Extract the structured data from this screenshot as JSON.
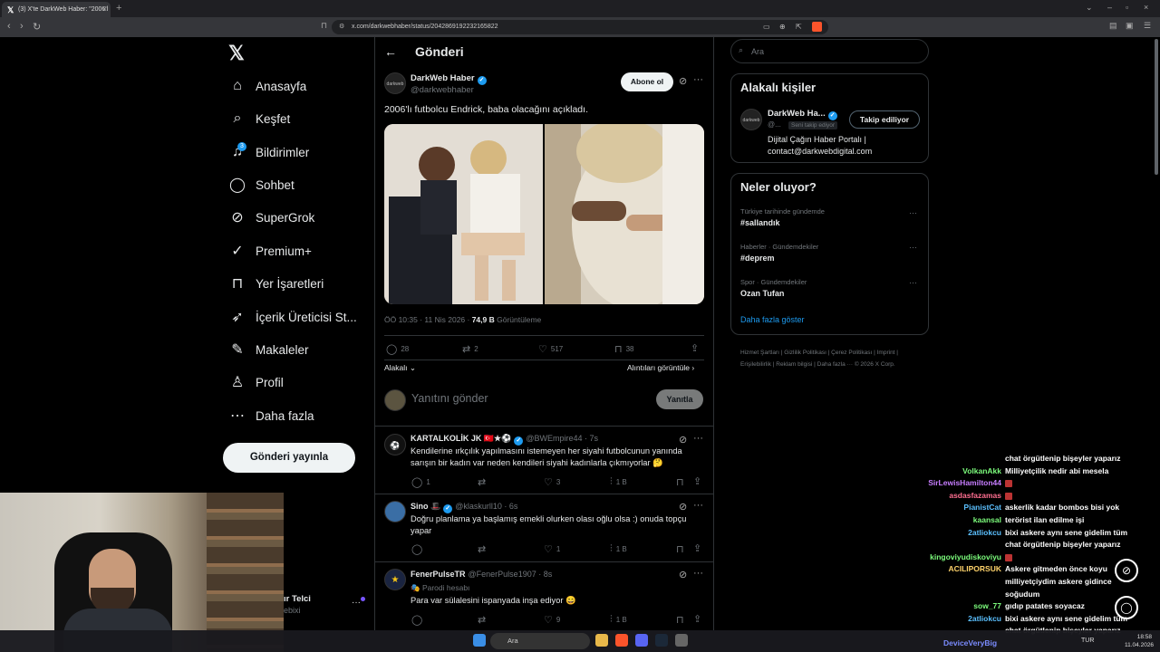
{
  "browser": {
    "tab_title": "(3) X'te DarkWeb Haber: \"2006'l",
    "url": "x.com/darkwebhaber/status/2042869192232165822"
  },
  "nav": {
    "items": [
      {
        "label": "Anasayfa",
        "icon": "home-icon"
      },
      {
        "label": "Keşfet",
        "icon": "search-icon"
      },
      {
        "label": "Bildirimler",
        "icon": "bell-icon"
      },
      {
        "label": "Sohbet",
        "icon": "chat-icon"
      },
      {
        "label": "SuperGrok",
        "icon": "grok-icon"
      },
      {
        "label": "Premium+",
        "icon": "verified-icon"
      },
      {
        "label": "Yer İşaretleri",
        "icon": "bookmark-icon"
      },
      {
        "label": "İçerik Üreticisi St...",
        "icon": "rocket-icon"
      },
      {
        "label": "Makaleler",
        "icon": "article-icon"
      },
      {
        "label": "Profil",
        "icon": "person-icon"
      },
      {
        "label": "Daha fazla",
        "icon": "more-circle-icon"
      }
    ],
    "notifications_badge": "3",
    "post_button": "Gönderi yayınla",
    "account_name": "ır Telci",
    "account_handle": "ebixi"
  },
  "post": {
    "page_title": "Gönderi",
    "author_name": "DarkWeb Haber",
    "author_handle": "@darkwebhaber",
    "avatar_text": "darkweb",
    "follow_label": "Abone ol",
    "text": "2006'lı futbolcu Endrick, baba olacağını açıkladı.",
    "time": "ÖÖ 10:35 · 11 Nis 2026 · ",
    "views_count": "74,9 B",
    "views_label": " Görüntüleme",
    "replies": "28",
    "reposts": "2",
    "likes": "517",
    "bookmarks": "38",
    "sort_label": "Alakalı",
    "quotes_label": "Alıntıları görüntüle",
    "reply_placeholder": "Yanıtını gönder",
    "reply_button": "Yanıtla"
  },
  "replies": [
    {
      "name": "KARTALKOLİK JK 🇹🇷★⚽",
      "handle": "@BWEmpire44 · 7s",
      "text": "Kendilerine ırkçılık yapılmasını istemeyen her siyahi futbolcunun yanında sarışın bir kadın var neden kendileri  siyahi kadınlarla çıkmıyorlar 🤔",
      "replies": "1",
      "likes": "3",
      "views": "1 B"
    },
    {
      "name": "Sino 🎩",
      "handle": "@klaskurll10 · 6s",
      "text": "Doğru planlama ya başlamış emekli olurken olası oğlu olsa :) onuda topçu yapar",
      "replies": "",
      "likes": "1",
      "views": "1 B"
    },
    {
      "name": "FenerPulseTR",
      "handle": "@FenerPulse1907 · 8s",
      "parody": "Parodi hesabı",
      "text": "Para var sülalesini ispanyada inşa ediyor 😄",
      "replies": "",
      "likes": "9",
      "views": "1 B"
    }
  ],
  "right": {
    "search_placeholder": "Ara",
    "related_title": "Alakalı kişiler",
    "related_name": "DarkWeb Ha...",
    "related_handle": "@...",
    "related_badge": "Seni takip ediyor",
    "related_button": "Takip ediliyor",
    "related_bio": "Dijital Çağın Haber Portalı | contact@darkwebdigital.com",
    "trends_title": "Neler oluyor?",
    "trends": [
      {
        "context": "Türkiye tarihinde gündemde",
        "name": "#sallandık"
      },
      {
        "context": "Haberler · Gündemdekiler",
        "name": "#deprem"
      },
      {
        "context": "Spor · Gündemdekiler",
        "name": "Ozan Tufan"
      }
    ],
    "show_more": "Daha fazla göster",
    "footer": "Hizmet Şartları  |  Gizlilik Politikası  |  Çerez Politikası  |  Imprint  |  Erişilebilirlik  |  Reklam bilgisi  |  Daha fazla ···  © 2026 X Corp."
  },
  "chat": [
    {
      "user": "",
      "msg": "chat örgütlenip bişeyler yaparız",
      "color": "#ffffff"
    },
    {
      "user": "VolkanAkk",
      "msg": "Milliyetçilik nedir abi mesela",
      "color": "#7cfc7c"
    },
    {
      "user": "SirLewisHamilton44",
      "msg": "",
      "color": "#c77dff"
    },
    {
      "user": "asdasfazamas",
      "msg": "",
      "color": "#ff6f91"
    },
    {
      "user": "PianistCat",
      "msg": "askerlik kadar bombos bisi yok",
      "color": "#5bc0ff"
    },
    {
      "user": "kaansal",
      "msg": "terörist ilan edilme işi",
      "color": "#7cfc7c"
    },
    {
      "user": "2atliokcu",
      "msg": "bixi askere aynı sene gidelim tüm",
      "color": "#5bc0ff"
    },
    {
      "user": "",
      "msg": "chat örgütlenip bişeyler yaparız",
      "color": "#ffffff"
    },
    {
      "user": "kingoviyudiskoviyu",
      "msg": "",
      "color": "#7cfc7c"
    },
    {
      "user": "ACILIPORSUK",
      "msg": "Askere gitmeden önce koyu",
      "color": "#ffd36b"
    },
    {
      "user": "",
      "msg": "milliyetçiydim askere gidince",
      "color": "#ffffff"
    },
    {
      "user": "",
      "msg": "soğudum",
      "color": "#ffffff"
    },
    {
      "user": "sow_77",
      "msg": "gıdıp patates soyacaz",
      "color": "#7cfc7c"
    },
    {
      "user": "2atliokcu",
      "msg": "bixi askere aynı sene gidelim tüm",
      "color": "#5bc0ff"
    },
    {
      "user": "",
      "msg": "chat örgütlenip bişeyler yaparız",
      "color": "#ffffff"
    }
  ],
  "taskbar": {
    "search": "Ara",
    "streamer": "DeviceVeryBig",
    "lang": "TUR",
    "time": "18:58",
    "date": "11.04.2026"
  },
  "colors": {
    "accent": "#1d9bf0",
    "background": "#000000",
    "border": "#2f3336"
  }
}
